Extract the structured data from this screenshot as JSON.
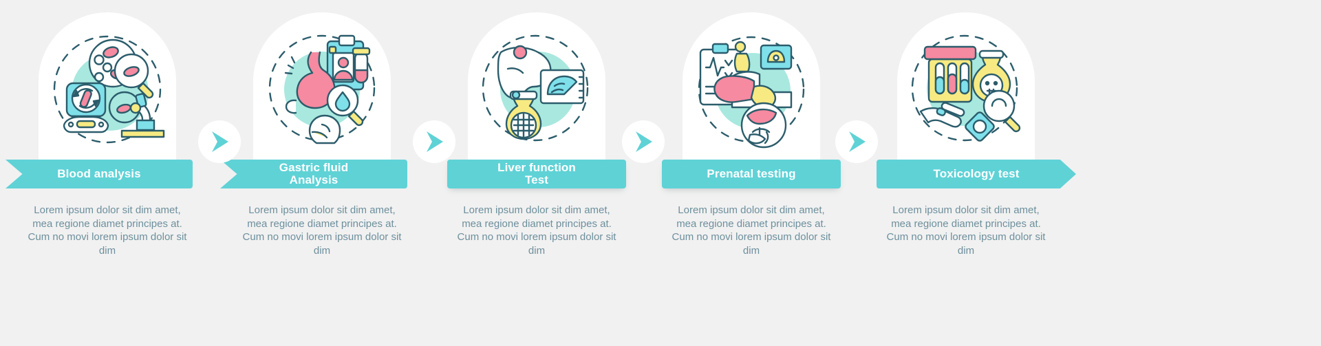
{
  "theme": {
    "background": "#f1f1f1",
    "banner_color": "#5fd2d6",
    "banner_text_color": "#ffffff",
    "body_text_color": "#6d8f9c",
    "arch_color": "#ffffff",
    "icon_outline": "#2b5c6b",
    "icon_mint": "#a9e8df",
    "icon_pink": "#f58aa0",
    "icon_yellow": "#f7ea82",
    "icon_cyan": "#7fe0ea"
  },
  "shared": {
    "description": "Lorem ipsum dolor sit dim amet, mea regione diamet principes at. Cum no movi lorem ipsum dolor sit dim"
  },
  "connectors": [
    {
      "name": "arrow-1-2",
      "icon": "chevron-right-icon"
    },
    {
      "name": "arrow-2-3",
      "icon": "chevron-right-icon"
    },
    {
      "name": "arrow-3-4",
      "icon": "chevron-right-icon"
    },
    {
      "name": "arrow-4-5",
      "icon": "chevron-right-icon"
    }
  ],
  "steps": [
    {
      "id": "blood-analysis",
      "label": "Blood analysis",
      "banner_style": "notch-left",
      "icon": "blood-analysis-icon",
      "description": "Lorem ipsum dolor sit dim amet, mea regione diamet principes at. Cum no movi lorem ipsum dolor sit dim"
    },
    {
      "id": "gastric-fluid-analysis",
      "label": "Gastric fluid\nAnalysis",
      "banner_style": "notch-left",
      "icon": "gastric-fluid-icon",
      "description": "Lorem ipsum dolor sit dim amet, mea regione diamet principes at. Cum no movi lorem ipsum dolor sit dim"
    },
    {
      "id": "liver-function-test",
      "label": "Liver function\nTest",
      "banner_style": "plain",
      "icon": "liver-function-icon",
      "description": "Lorem ipsum dolor sit dim amet, mea regione diamet principes at. Cum no movi lorem ipsum dolor sit dim"
    },
    {
      "id": "prenatal-testing",
      "label": "Prenatal testing",
      "banner_style": "plain",
      "icon": "prenatal-testing-icon",
      "description": "Lorem ipsum dolor sit dim amet, mea regione diamet principes at. Cum no movi lorem ipsum dolor sit dim"
    },
    {
      "id": "toxicology-test",
      "label": "Toxicology test",
      "banner_style": "point-right",
      "icon": "toxicology-test-icon",
      "description": "Lorem ipsum dolor sit dim amet, mea regione diamet principes at. Cum no movi lorem ipsum dolor sit dim"
    }
  ]
}
